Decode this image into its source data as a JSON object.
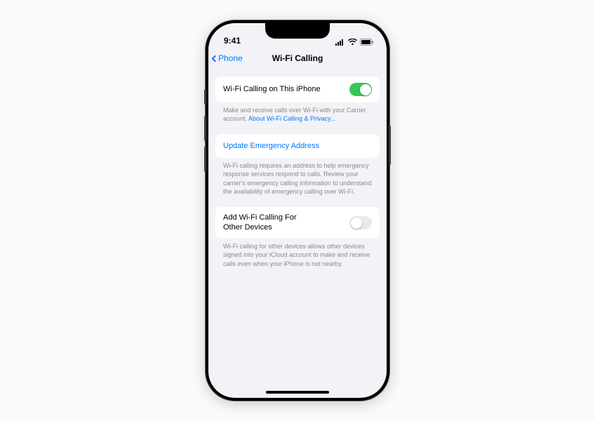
{
  "statusBar": {
    "time": "9:41"
  },
  "nav": {
    "back": "Phone",
    "title": "Wi-Fi Calling"
  },
  "groups": {
    "wifiCalling": {
      "label": "Wi-Fi Calling on This iPhone",
      "enabled": true,
      "footerPrefix": "Make and receive calls over Wi-Fi with your Carrier account. ",
      "footerLink": "About Wi-Fi Calling & Privacy..."
    },
    "emergency": {
      "label": "Update Emergency Address",
      "footer": "Wi-Fi calling requires an address to help emergency response services respond to calls. Review your carrier's emergency calling information to understand the availability of emergency calling over Wi-Fi."
    },
    "otherDevices": {
      "label": "Add Wi-Fi Calling For Other Devices",
      "enabled": false,
      "footer": "Wi-Fi calling for other devices allows other devices signed into your iCloud account to make and receive calls even when your iPhone is not nearby."
    }
  }
}
